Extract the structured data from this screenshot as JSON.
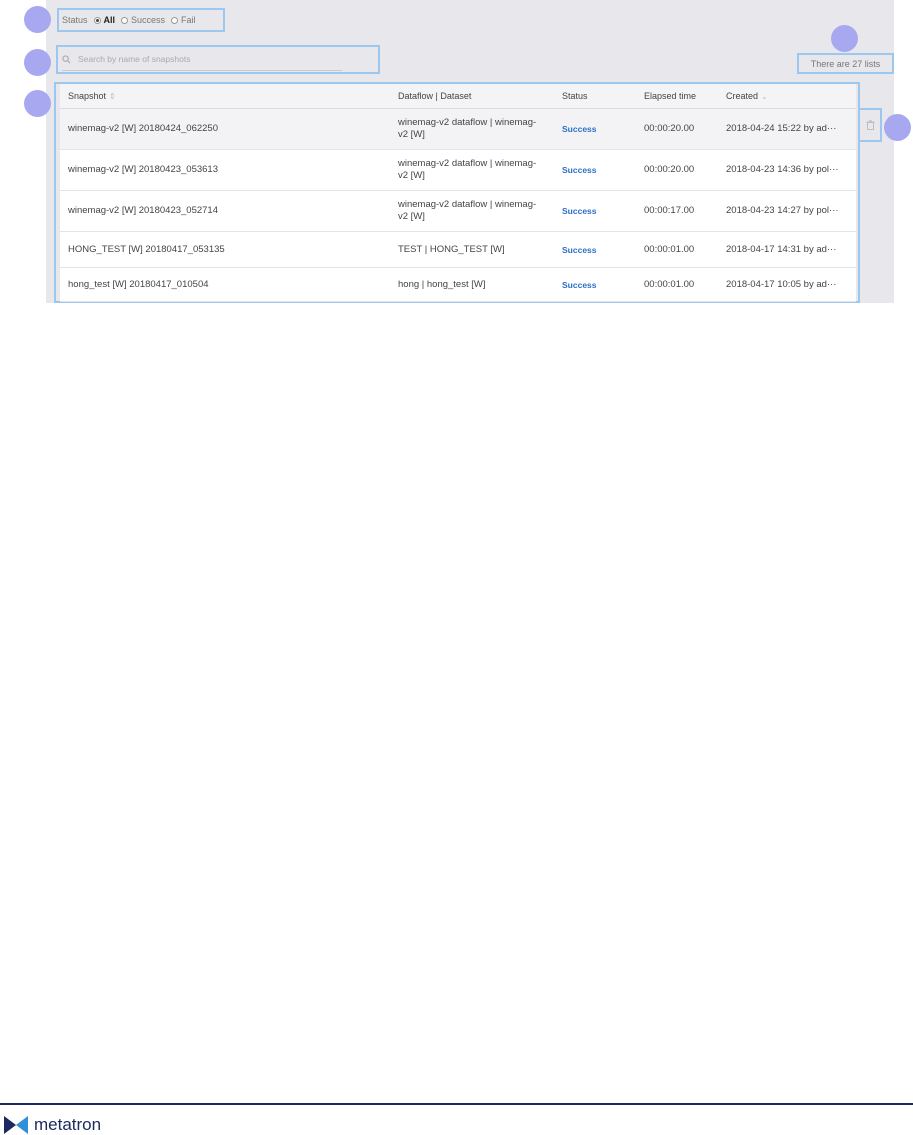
{
  "status_filter": {
    "label": "Status",
    "options": [
      {
        "label": "All",
        "selected": true
      },
      {
        "label": "Success",
        "selected": false
      },
      {
        "label": "Fail",
        "selected": false
      }
    ]
  },
  "search": {
    "placeholder": "Search by name of snapshots",
    "value": ""
  },
  "count_text": "There are 27 lists",
  "table": {
    "headers": [
      "Snapshot",
      "Dataflow | Dataset",
      "Status",
      "Elapsed time",
      "Created"
    ],
    "rows": [
      {
        "snapshot": "winemag-v2 [W] 20180424_062250",
        "dataflow": "winemag-v2 dataflow | winemag-v2 [W]",
        "status": "Success",
        "elapsed": "00:00:20.00",
        "created": "2018-04-24 15:22",
        "by": "by ad···"
      },
      {
        "snapshot": "winemag-v2 [W] 20180423_053613",
        "dataflow": "winemag-v2 dataflow | winemag-v2 [W]",
        "status": "Success",
        "elapsed": "00:00:20.00",
        "created": "2018-04-23 14:36",
        "by": "by pol···"
      },
      {
        "snapshot": "winemag-v2 [W] 20180423_052714",
        "dataflow": "winemag-v2 dataflow | winemag-v2 [W]",
        "status": "Success",
        "elapsed": "00:00:17.00",
        "created": "2018-04-23 14:27",
        "by": "by pol···"
      },
      {
        "snapshot": "HONG_TEST [W] 20180417_053135",
        "dataflow": "TEST | HONG_TEST [W]",
        "status": "Success",
        "elapsed": "00:00:01.00",
        "created": "2018-04-17 14:31",
        "by": "by ad···"
      },
      {
        "snapshot": "hong_test [W] 20180417_010504",
        "dataflow": "hong | hong_test [W]",
        "status": "Success",
        "elapsed": "00:00:01.00",
        "created": "2018-04-17 10:05",
        "by": "by ad···"
      }
    ]
  },
  "icons": {
    "search": "search-icon",
    "trash": "trash-icon",
    "sort": "sort-icon"
  },
  "colors": {
    "accent": "#9cc7ee",
    "callout": "#a8a8f0",
    "status_success": "#2b6fc8",
    "brand": "#1b2a5e"
  },
  "footer": {
    "logo_text": "metatron"
  }
}
